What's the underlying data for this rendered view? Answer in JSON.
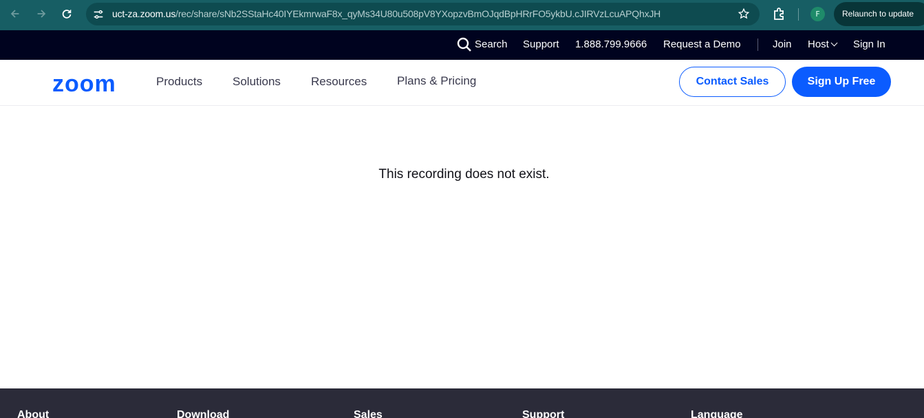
{
  "browser": {
    "url_host": "uct-za.zoom.us",
    "url_path": "/rec/share/sNb2SStaHc40IYEkmrwaF8x_qyMs34U80u508pV8YXopzvBmOJqdBpHRrFO5ykbU.cJIRVzLcuAPQhxJH",
    "profile_initial": "F",
    "relaunch_label": "Relaunch to update"
  },
  "utility_bar": {
    "search_label": "Search",
    "support_label": "Support",
    "phone": "1.888.799.9666",
    "demo_label": "Request a Demo",
    "join_label": "Join",
    "host_label": "Host",
    "signin_label": "Sign In"
  },
  "main_nav": {
    "logo_text": "zoom",
    "products": "Products",
    "solutions": "Solutions",
    "resources": "Resources",
    "plans": "Plans & Pricing",
    "contact_sales": "Contact Sales",
    "signup_free": "Sign Up Free"
  },
  "content": {
    "message": "This recording does not exist."
  },
  "footer": {
    "columns": [
      "About",
      "Download",
      "Sales",
      "Support",
      "Language"
    ]
  },
  "colors": {
    "brand_blue": "#0b5cff",
    "utility_bg": "#00031f",
    "footer_bg": "#2b2b39",
    "chrome_bg": "#175e64"
  }
}
